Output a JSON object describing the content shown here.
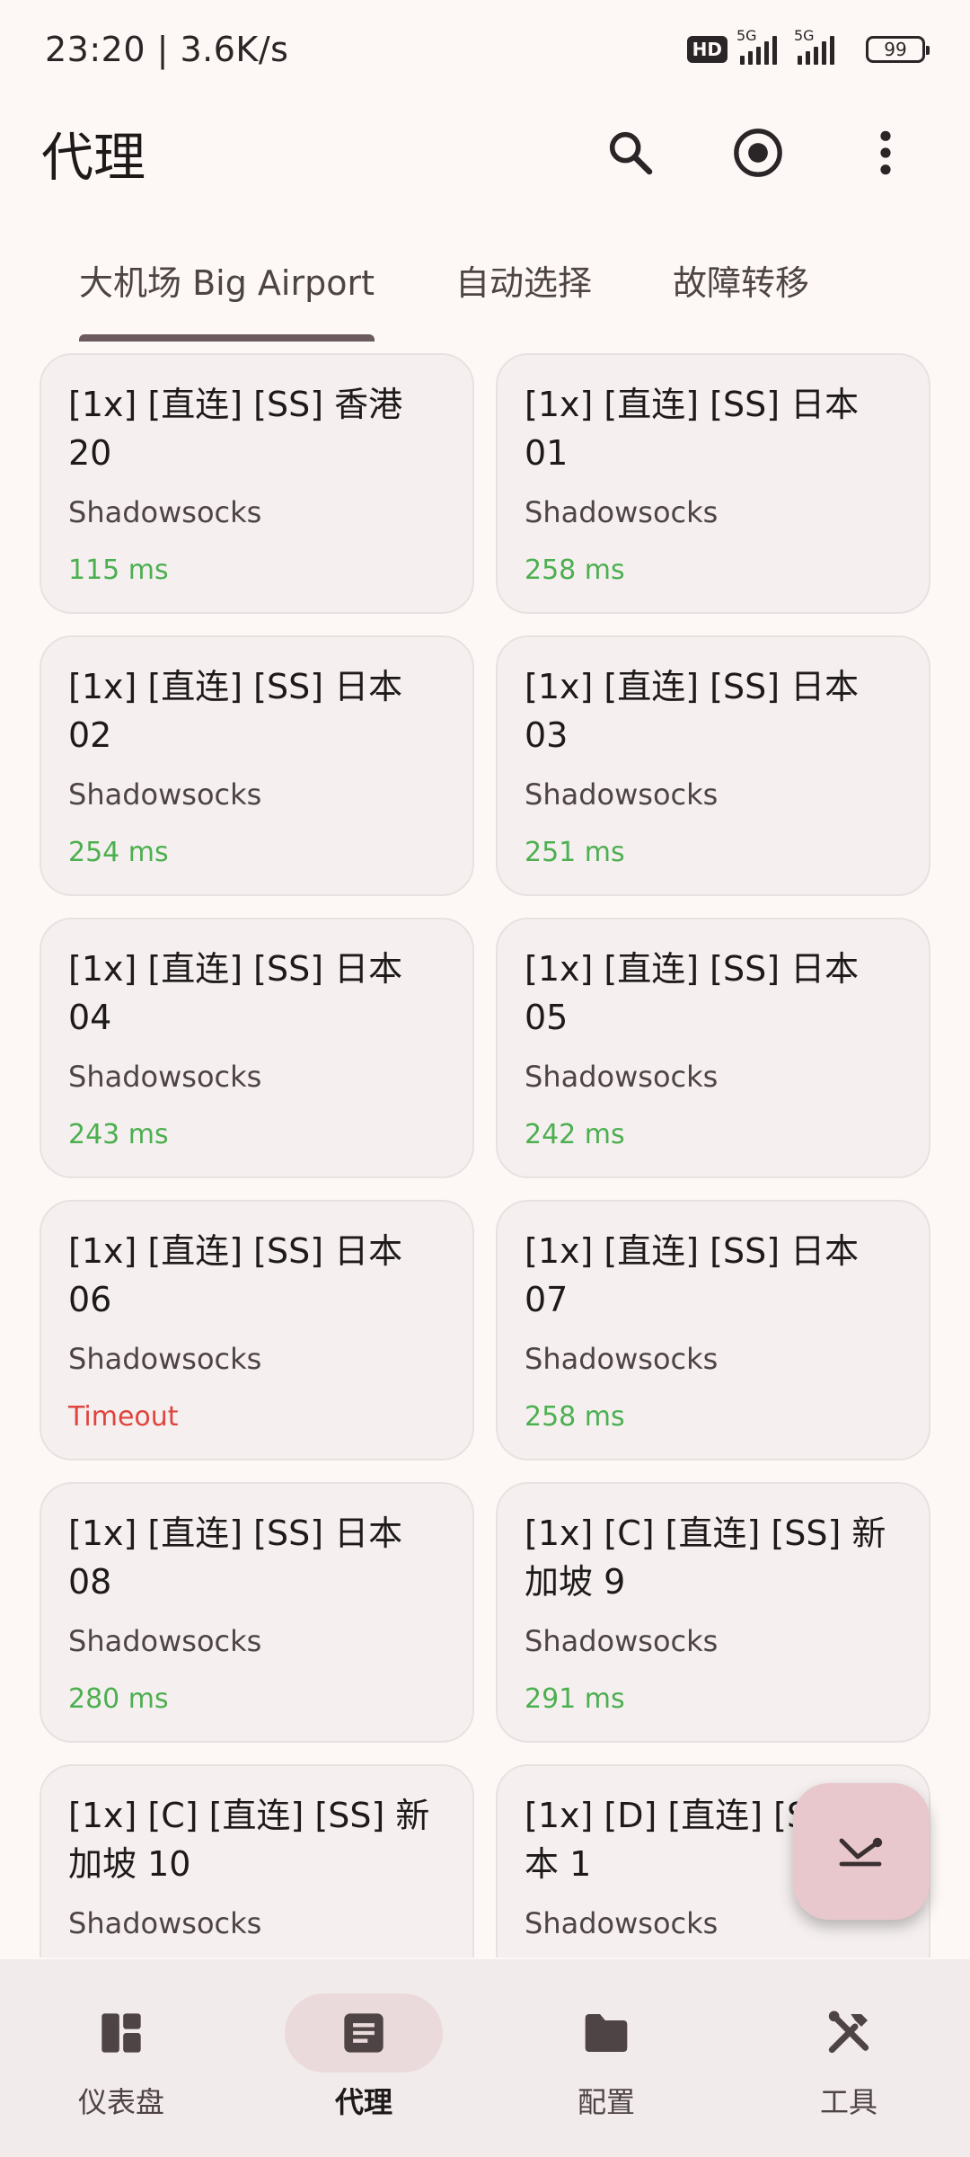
{
  "status_bar": {
    "time_speed": "23:20 | 3.6K/s",
    "hd_label": "HD",
    "network1": "5G",
    "network2": "5G",
    "battery": "99"
  },
  "app_bar": {
    "title": "代理",
    "icons": [
      "search-icon",
      "target-icon",
      "more-vert-icon"
    ]
  },
  "tabs": [
    {
      "label": "大机场 Big Airport",
      "active": true
    },
    {
      "label": "自动选择",
      "active": false
    },
    {
      "label": "故障转移",
      "active": false
    }
  ],
  "proxies": [
    {
      "name": "[1x] [直连] [SS] 香港 20",
      "type": "Shadowsocks",
      "delay": "115 ms",
      "status": "ok"
    },
    {
      "name": "[1x] [直连] [SS] 日本 01",
      "type": "Shadowsocks",
      "delay": "258 ms",
      "status": "ok"
    },
    {
      "name": "[1x] [直连] [SS] 日本 02",
      "type": "Shadowsocks",
      "delay": "254 ms",
      "status": "ok"
    },
    {
      "name": "[1x] [直连] [SS] 日本 03",
      "type": "Shadowsocks",
      "delay": "251 ms",
      "status": "ok"
    },
    {
      "name": "[1x] [直连] [SS] 日本 04",
      "type": "Shadowsocks",
      "delay": "243 ms",
      "status": "ok"
    },
    {
      "name": "[1x] [直连] [SS] 日本 05",
      "type": "Shadowsocks",
      "delay": "242 ms",
      "status": "ok"
    },
    {
      "name": "[1x] [直连] [SS] 日本 06",
      "type": "Shadowsocks",
      "delay": "Timeout",
      "status": "timeout"
    },
    {
      "name": "[1x] [直连] [SS] 日本 07",
      "type": "Shadowsocks",
      "delay": "258 ms",
      "status": "ok"
    },
    {
      "name": "[1x] [直连] [SS] 日本 08",
      "type": "Shadowsocks",
      "delay": "280 ms",
      "status": "ok"
    },
    {
      "name": "[1x] [C] [直连] [SS] 新加坡 9",
      "type": "Shadowsocks",
      "delay": "291 ms",
      "status": "ok"
    },
    {
      "name": "[1x] [C] [直连] [SS] 新加坡 10",
      "type": "Shadowsocks",
      "delay": "",
      "status": "ok"
    },
    {
      "name": "[1x] [D] [直连] [SS] 日本 1",
      "type": "Shadowsocks",
      "delay": "",
      "status": "ok"
    }
  ],
  "fab": {
    "icon": "test-delay-icon"
  },
  "bottom_nav": [
    {
      "label": "仪表盘",
      "icon": "dashboard-icon",
      "active": false
    },
    {
      "label": "代理",
      "icon": "article-icon",
      "active": true
    },
    {
      "label": "配置",
      "icon": "folder-icon",
      "active": false
    },
    {
      "label": "工具",
      "icon": "tools-icon",
      "active": false
    }
  ],
  "colors": {
    "ok_delay": "#4CAF50",
    "timeout_delay": "#E0443E",
    "accent": "#6C5B5E",
    "fab": "#E8C8CC"
  }
}
